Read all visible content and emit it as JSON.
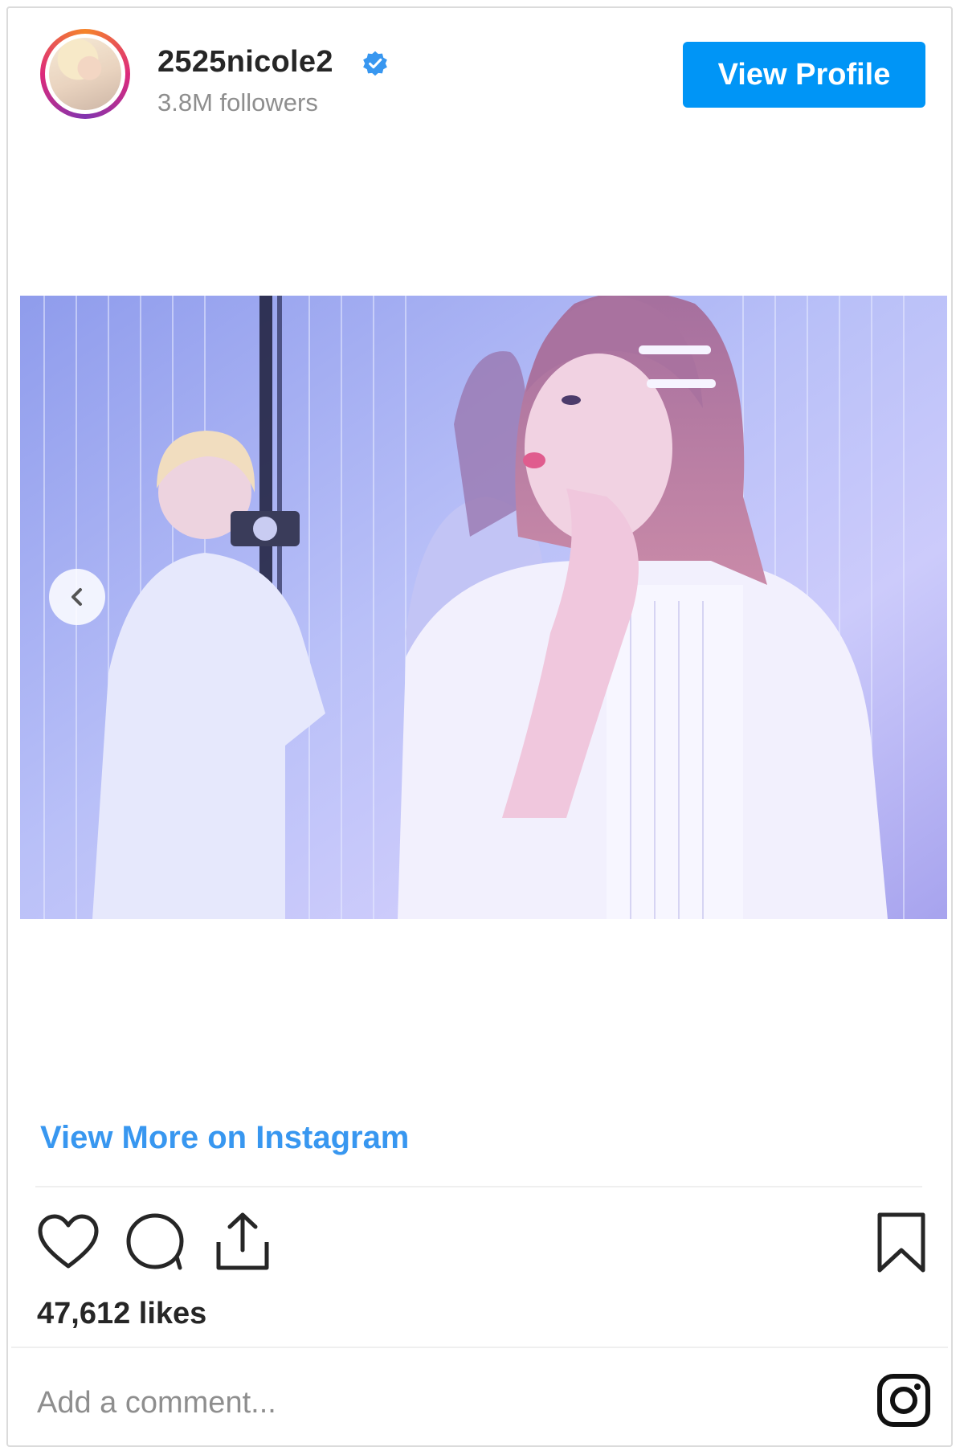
{
  "header": {
    "username": "2525nicole2",
    "followers": "3.8M followers",
    "view_profile_label": "View Profile"
  },
  "post": {
    "view_more_label": "View More on Instagram",
    "likes": "47,612 likes"
  },
  "comment": {
    "placeholder": "Add a comment..."
  },
  "icons": {
    "verified": "verified-badge-icon",
    "carousel_prev": "chevron-left-icon",
    "like": "heart-icon",
    "comment": "comment-bubble-icon",
    "share": "share-icon",
    "save": "bookmark-icon",
    "instagram": "instagram-logo-icon"
  },
  "colors": {
    "accent": "#0095f6",
    "link": "#3897f0",
    "text": "#262626",
    "muted": "#8e8e8e"
  }
}
